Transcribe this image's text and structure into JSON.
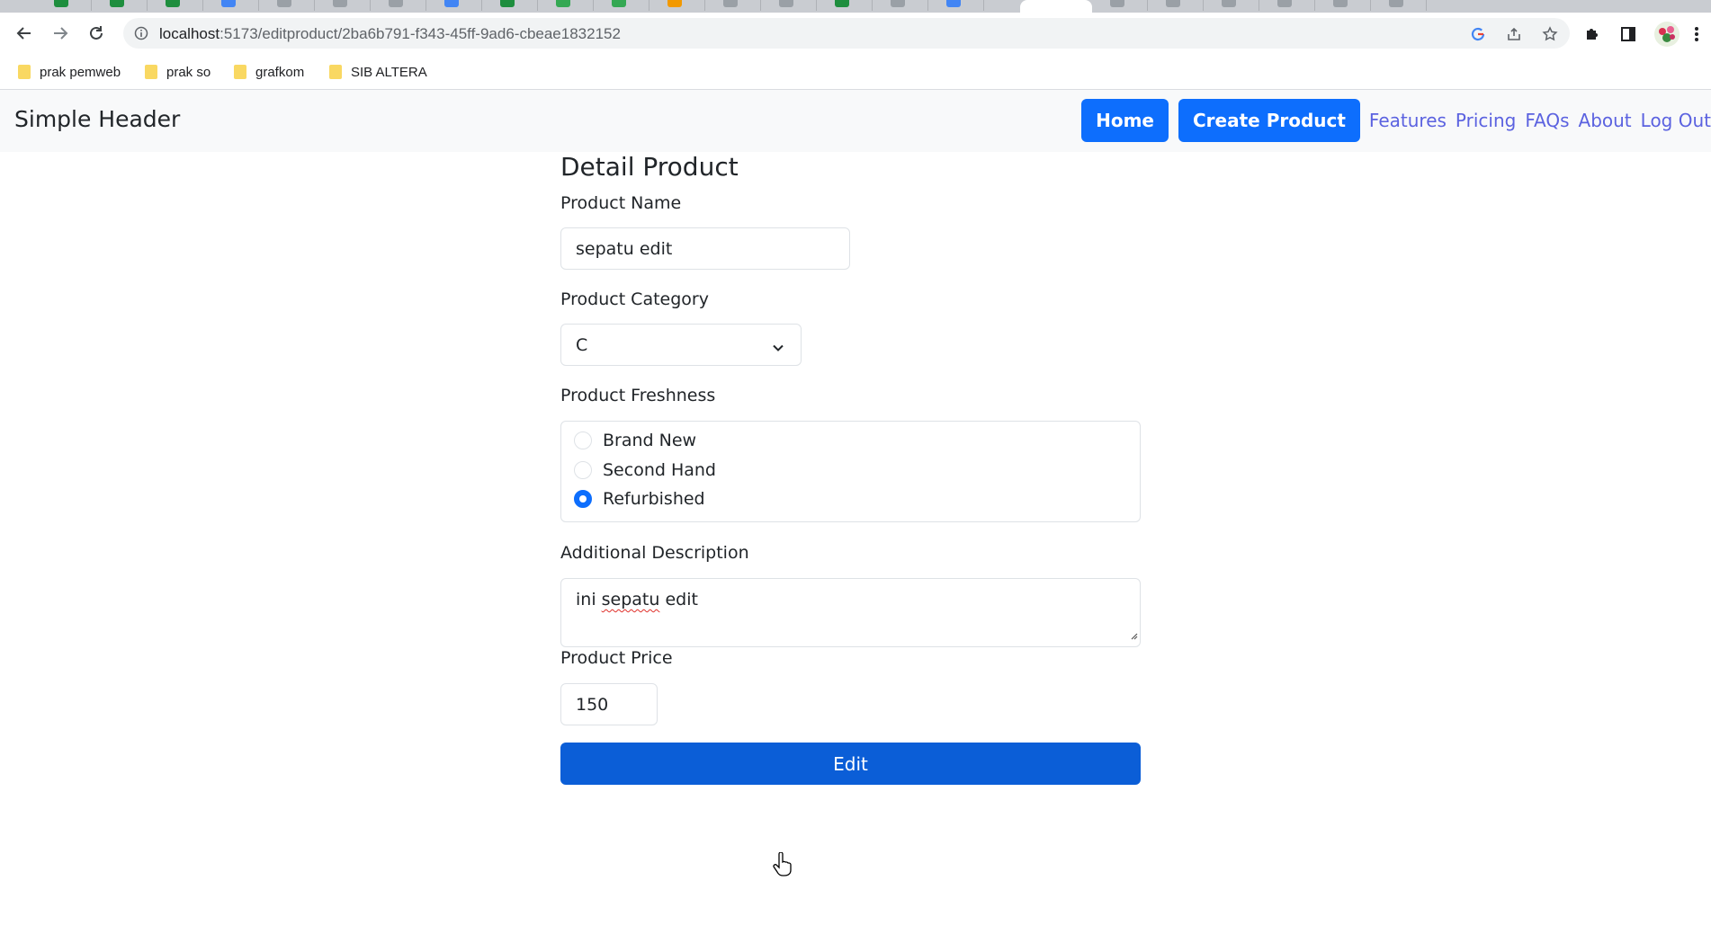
{
  "browser": {
    "url_host": "localhost",
    "url_path": ":5173/editproduct/2ba6b791-f343-45ff-9ad6-cbeae1832152",
    "bookmarks": [
      "prak pemweb",
      "prak so",
      "grafkom",
      "SIB ALTERA"
    ]
  },
  "header": {
    "brand": "Simple Header",
    "nav": {
      "home": "Home",
      "create_product": "Create Product",
      "features": "Features",
      "pricing": "Pricing",
      "faqs": "FAQs",
      "about": "About",
      "logout": "Log Out"
    }
  },
  "form": {
    "title": "Detail Product",
    "product_name_label": "Product Name",
    "product_name_value": "sepatu edit",
    "category_label": "Product Category",
    "category_value": "C",
    "freshness_label": "Product Freshness",
    "freshness_options": [
      "Brand New",
      "Second Hand",
      "Refurbished"
    ],
    "freshness_selected": "Refurbished",
    "description_label": "Additional Description",
    "description_value_pre": "ini ",
    "description_value_misspelled": "sepatu",
    "description_value_post": " edit",
    "price_label": "Product Price",
    "price_value": "150",
    "submit_label": "Edit"
  },
  "colors": {
    "primary": "#0d6efd",
    "submit": "#0b5ed7",
    "nav_link": "#5b62e0",
    "header_bg": "#f8f9fa"
  }
}
